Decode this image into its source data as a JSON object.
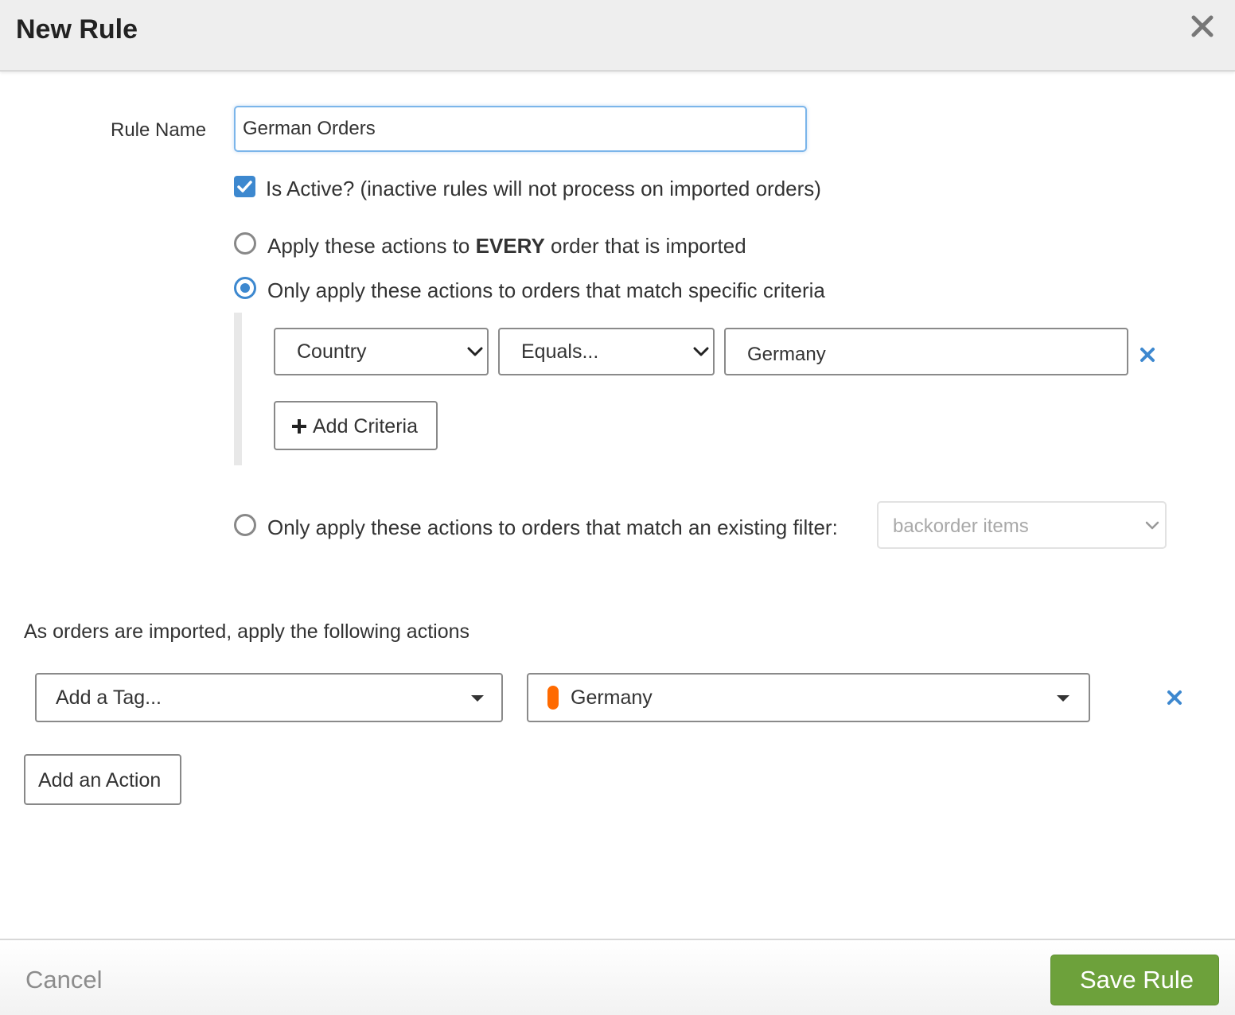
{
  "dialog": {
    "title": "New Rule",
    "close_icon": "close-icon"
  },
  "form": {
    "rule_name_label": "Rule Name",
    "rule_name_value": "German Orders",
    "is_active_checked": true,
    "is_active_label": "Is Active? (inactive rules will not process on imported orders)",
    "apply_mode": {
      "selected": "criteria",
      "every_prefix": "Apply these actions to ",
      "every_emphasis": "EVERY",
      "every_suffix": " order that is imported",
      "criteria_label": "Only apply these actions to orders that match specific criteria",
      "filter_label": "Only apply these actions to orders that match an existing filter:",
      "filter_placeholder": "backorder items"
    },
    "criteria": [
      {
        "field": "Country",
        "operator": "Equals...",
        "value": "Germany"
      }
    ],
    "add_criteria_label": "Add Criteria"
  },
  "actions": {
    "heading": "As orders are imported, apply the following actions",
    "items": [
      {
        "type": "Add a Tag...",
        "tag": "Germany",
        "tag_color": "#ff6a00"
      }
    ],
    "add_action_label": "Add an Action"
  },
  "footer": {
    "cancel_label": "Cancel",
    "save_label": "Save Rule"
  },
  "colors": {
    "accent": "#3d88cf",
    "save_button": "#6da13b"
  }
}
